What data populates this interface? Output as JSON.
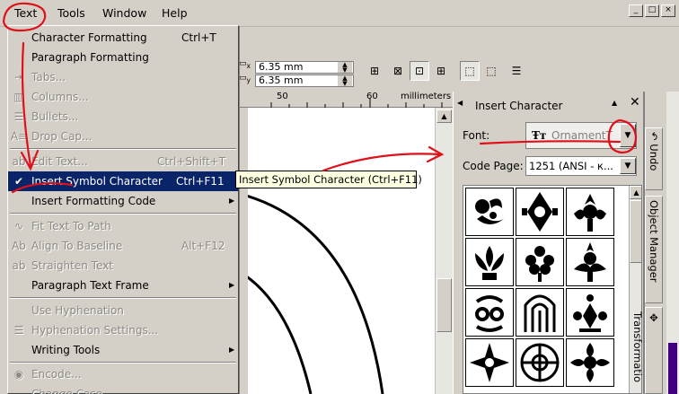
{
  "menubar": {
    "items": [
      "Text",
      "Tools",
      "Window",
      "Help"
    ],
    "window_buttons": [
      "_",
      "□",
      "×"
    ]
  },
  "text_menu": {
    "items": [
      {
        "label": "Character Formatting",
        "shortcut": "Ctrl+T",
        "disabled": false
      },
      {
        "label": "Paragraph Formatting",
        "shortcut": "",
        "disabled": false
      },
      {
        "label": "Tabs...",
        "shortcut": "",
        "disabled": true
      },
      {
        "label": "Columns...",
        "shortcut": "",
        "disabled": true
      },
      {
        "label": "Bullets...",
        "shortcut": "",
        "disabled": true
      },
      {
        "label": "Drop Cap...",
        "shortcut": "",
        "disabled": true
      },
      {
        "label": "Edit Text...",
        "shortcut": "Ctrl+Shift+T",
        "disabled": true
      },
      {
        "label": "Insert Symbol Character",
        "shortcut": "Ctrl+F11",
        "disabled": false,
        "selected": true
      },
      {
        "label": "Insert Formatting Code",
        "shortcut": "",
        "disabled": false,
        "submenu": true
      },
      {
        "label": "Fit Text To Path",
        "shortcut": "",
        "disabled": true
      },
      {
        "label": "Align To Baseline",
        "shortcut": "Alt+F12",
        "disabled": true
      },
      {
        "label": "Straighten Text",
        "shortcut": "",
        "disabled": true
      },
      {
        "label": "Paragraph Text Frame",
        "shortcut": "",
        "disabled": false,
        "submenu": true
      },
      {
        "label": "Use Hyphenation",
        "shortcut": "",
        "disabled": true
      },
      {
        "label": "Hyphenation Settings...",
        "shortcut": "",
        "disabled": true
      },
      {
        "label": "Writing Tools",
        "shortcut": "",
        "disabled": false,
        "submenu": true
      },
      {
        "label": "Encode...",
        "shortcut": "",
        "disabled": true
      },
      {
        "label": "Change Case...",
        "shortcut": "",
        "disabled": true
      }
    ]
  },
  "tooltip": {
    "text": "Insert Symbol Character (Ctrl+F11)"
  },
  "property_bar": {
    "width_value": "6.35 mm",
    "height_value": "6.35 mm",
    "x_label": "x",
    "y_label": "y"
  },
  "ruler": {
    "ticks": [
      "50",
      "60"
    ],
    "unit": "millimeters"
  },
  "docker": {
    "title": "Insert Character",
    "font_label": "Font:",
    "font_value": "OrnamentT",
    "code_page_label": "Code Page:",
    "code_page_value": "1251  (ANSI - к..."
  },
  "side_tabs": [
    "Undo",
    "Object Manager",
    "Transformatio"
  ],
  "colors": {
    "selection": "#0a246a",
    "annotation": "#e0101a",
    "tooltip_bg": "#ffffe1"
  }
}
